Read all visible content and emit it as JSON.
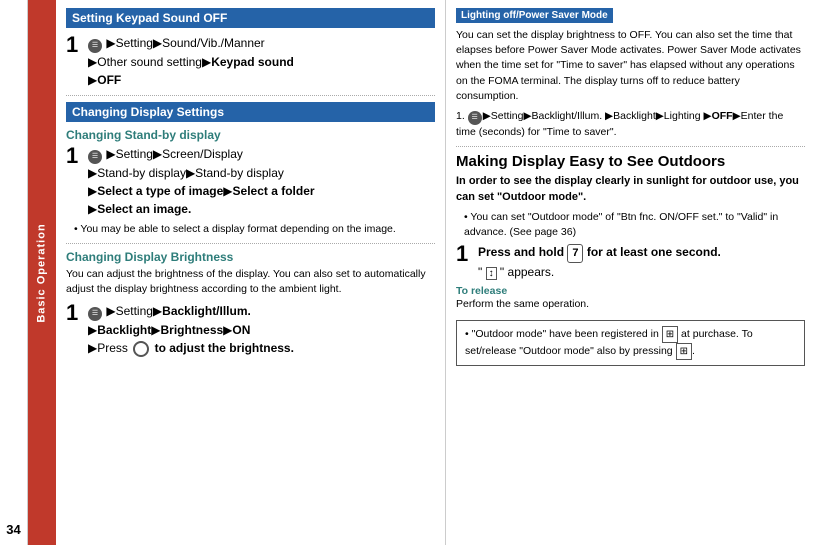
{
  "sidebar": {
    "label": "Basic Operation"
  },
  "page_number": "34",
  "left_column": {
    "section1": {
      "header": "Setting Keypad Sound OFF",
      "step1": {
        "number": "1",
        "lines": [
          "▶Setting▶Sound/Vib./Manner",
          "▶Other sound setting▶Keypad sound",
          "▶OFF"
        ]
      }
    },
    "section2": {
      "header": "Changing Display Settings",
      "subsection1": {
        "title": "Changing Stand-by display",
        "step1": {
          "number": "1",
          "lines": [
            "▶Setting▶Screen/Display",
            "▶Stand-by display▶Stand-by display",
            "▶Select a type of image▶Select a folder",
            "▶Select an image."
          ]
        },
        "note": "You may be able to select a display format depending on the image."
      },
      "subsection2": {
        "title": "Changing Display Brightness",
        "description": "You can adjust the brightness of the display. You can also set to automatically adjust the display brightness according to the ambient light.",
        "step1": {
          "number": "1",
          "lines": [
            "▶Setting▶Backlight/Illum.",
            "▶Backlight▶Brightness▶ON",
            "▶Press  to adjust the brightness."
          ]
        }
      }
    }
  },
  "right_column": {
    "lighting_section": {
      "badge": "Lighting off/Power Saver Mode",
      "description": "You can set the display brightness to OFF. You can also set the time that elapses before Power Saver Mode activates. Power Saver Mode activates when the time set for \"Time to saver\" has elapsed without any operations on the FOMA terminal. The display turns off to reduce battery consumption.",
      "step1_text": "1.  ▶Setting▶Backlight/Illum. ▶Backlight▶Lighting ▶OFF▶Enter the time (seconds) for \"Time to saver\"."
    },
    "outdoor_section": {
      "title": "Making Display Easy to See Outdoors",
      "description_bold": "In order to see the display clearly in sunlight for outdoor use, you can set \"Outdoor mode\".",
      "bullet1": "You can set \"Outdoor mode\" of \"Btn fnc. ON/OFF set.\" to \"Valid\" in advance. (See page 36)",
      "step1": {
        "number": "1",
        "text": "Press and hold  7  for at least one second.",
        "sub_text": "\" \" appears."
      },
      "to_release_label": "To release",
      "to_release_text": "Perform the same operation.",
      "bottom_note": "\"Outdoor mode\" have been registered in  at purchase. To set/release \"Outdoor mode\" also by pressing  ."
    }
  }
}
